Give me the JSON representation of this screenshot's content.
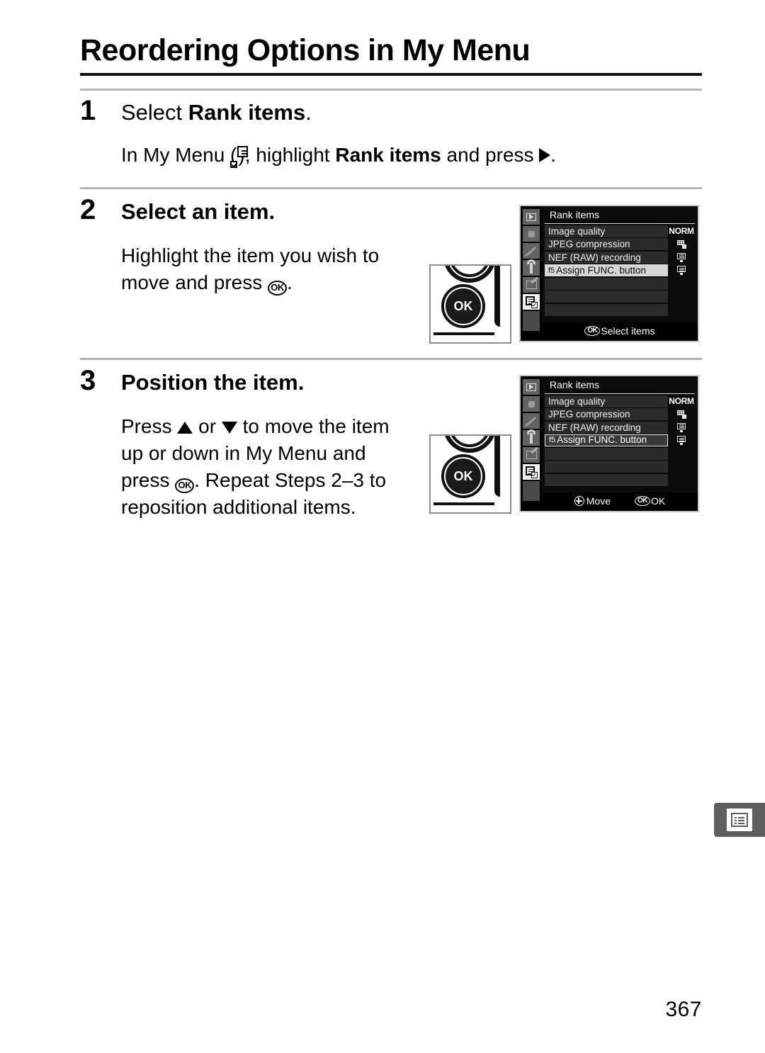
{
  "document": {
    "page_title": "Reordering Options in My Menu",
    "page_number": "367"
  },
  "steps": [
    {
      "number": "1",
      "title_prefix": "Select ",
      "title_bold": "Rank items",
      "title_suffix": ".",
      "body_parts": {
        "p1": "In My Menu (",
        "icon": "my-menu-icon",
        "p2": "), highlight ",
        "bold": "Rank items",
        "p3": " and press ",
        "arrow": "right-triangle-icon",
        "p4": "."
      }
    },
    {
      "number": "2",
      "title": "Select an item.",
      "body_parts": {
        "p1": "Highlight the item you wish to move and press ",
        "ok": "OK",
        "p2": "."
      }
    },
    {
      "number": "3",
      "title": "Position the item.",
      "body_parts": {
        "p1": "Press ",
        "up": "up-triangle-icon",
        "p2": " or ",
        "down": "down-triangle-icon",
        "p3": " to move the item up or down in My Menu and press ",
        "ok": "OK",
        "p4": ".  Repeat Steps 2–3 to reposition additional items."
      }
    }
  ],
  "illustrations": {
    "ok_button_label": "OK"
  },
  "lcd_screens": [
    {
      "id": "select-items-screen",
      "title": "Rank items",
      "sidebar": [
        {
          "name": "playback-menu-icon",
          "selected": false
        },
        {
          "name": "shooting-menu-icon",
          "selected": false
        },
        {
          "name": "custom-settings-menu-icon",
          "selected": false
        },
        {
          "name": "setup-menu-icon",
          "selected": false
        },
        {
          "name": "retouch-menu-icon",
          "selected": false
        },
        {
          "name": "my-menu-icon",
          "selected": true
        }
      ],
      "rows": [
        {
          "prefix": "",
          "label": "Image quality",
          "value": "NORM",
          "value_icon": "",
          "state": "normal"
        },
        {
          "prefix": "",
          "label": "JPEG compression",
          "value": "",
          "value_icon": "jpeg-compression-icon",
          "state": "normal"
        },
        {
          "prefix": "",
          "label": "NEF (RAW) recording",
          "value": "",
          "value_icon": "nef-raw-icon",
          "state": "normal"
        },
        {
          "prefix": "f5",
          "label": "Assign FUNC. button",
          "value": "",
          "value_icon": "nef-raw-icon",
          "state": "selected-fill"
        },
        {
          "prefix": "",
          "label": "",
          "value": "",
          "value_icon": "",
          "state": "empty"
        },
        {
          "prefix": "",
          "label": "",
          "value": "",
          "value_icon": "",
          "state": "empty"
        },
        {
          "prefix": "",
          "label": "",
          "value": "",
          "value_icon": "",
          "state": "empty"
        }
      ],
      "footer": [
        {
          "badge": "OK",
          "badge_type": "ok",
          "label": "Select items"
        }
      ]
    },
    {
      "id": "move-item-screen",
      "title": "Rank items",
      "sidebar": [
        {
          "name": "playback-menu-icon",
          "selected": false
        },
        {
          "name": "shooting-menu-icon",
          "selected": false
        },
        {
          "name": "custom-settings-menu-icon",
          "selected": false
        },
        {
          "name": "setup-menu-icon",
          "selected": false
        },
        {
          "name": "retouch-menu-icon",
          "selected": false
        },
        {
          "name": "my-menu-icon",
          "selected": true
        }
      ],
      "rows": [
        {
          "prefix": "",
          "label": "Image quality",
          "value": "NORM",
          "value_icon": "",
          "state": "normal"
        },
        {
          "prefix": "",
          "label": "JPEG compression",
          "value": "",
          "value_icon": "jpeg-compression-icon",
          "state": "normal"
        },
        {
          "prefix": "",
          "label": "NEF (RAW) recording",
          "value": "",
          "value_icon": "nef-raw-icon",
          "state": "normal"
        },
        {
          "prefix": "f5",
          "label": "Assign FUNC. button",
          "value": "",
          "value_icon": "nef-raw-icon",
          "state": "selected-outline"
        },
        {
          "prefix": "",
          "label": "",
          "value": "",
          "value_icon": "",
          "state": "empty"
        },
        {
          "prefix": "",
          "label": "",
          "value": "",
          "value_icon": "",
          "state": "empty"
        },
        {
          "prefix": "",
          "label": "",
          "value": "",
          "value_icon": "",
          "state": "empty"
        }
      ],
      "footer": [
        {
          "badge": "",
          "badge_type": "multi-selector",
          "label": "Move"
        },
        {
          "badge": "OK",
          "badge_type": "ok",
          "label": "OK"
        }
      ]
    }
  ],
  "edge_tab": {
    "name": "my-menu-chapter-tab"
  },
  "colors": {
    "text": "#000000",
    "rule": "#b4b4b4",
    "title_rule": "#111111",
    "lcd_background": "#0b0b0b",
    "lcd_row": "#2b2b2b",
    "lcd_selected_fill": "#d6d6d6",
    "edge_tab": "#5e5e5e"
  }
}
